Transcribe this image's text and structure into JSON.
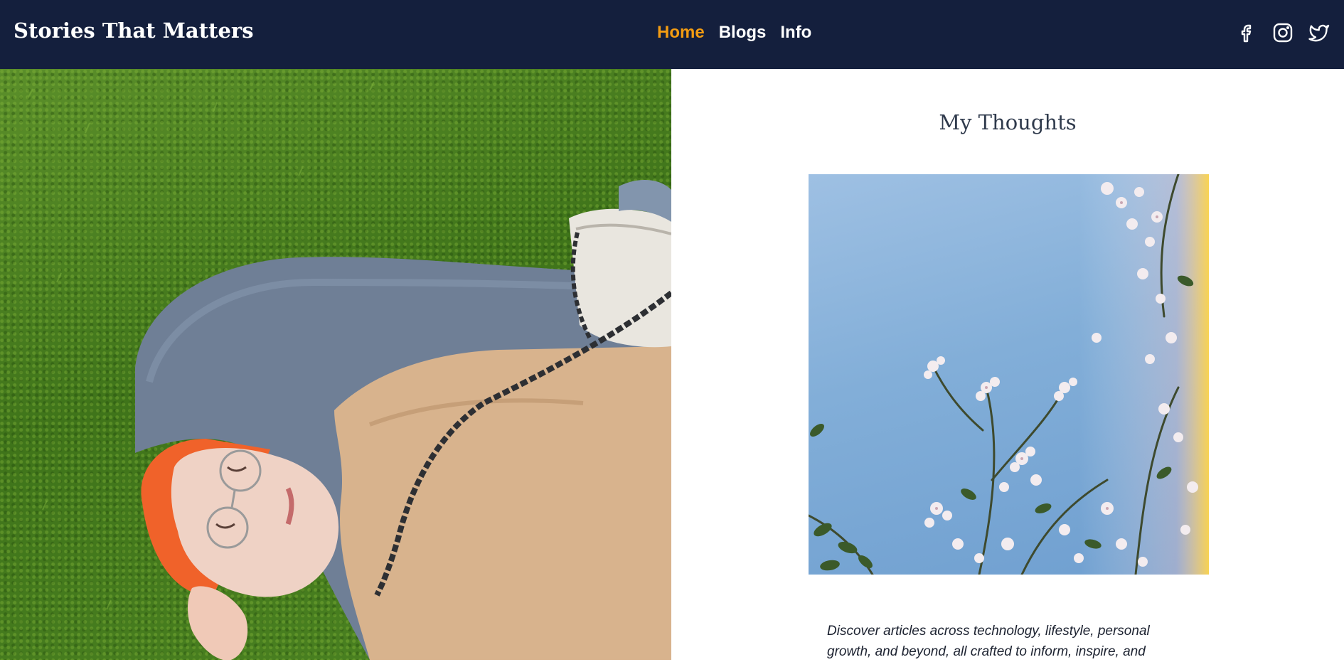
{
  "navbar": {
    "brand": "Stories That Matters",
    "links": [
      {
        "label": "Home",
        "active": true
      },
      {
        "label": "Blogs",
        "active": false
      },
      {
        "label": "Info",
        "active": false
      }
    ],
    "socials": [
      "facebook-icon",
      "instagram-icon",
      "twitter-icon"
    ]
  },
  "main": {
    "section_title": "My Thoughts",
    "intro_text": "Discover articles across technology, lifestyle, personal growth, and beyond, all crafted to inform, inspire, and"
  },
  "colors": {
    "navbar_bg": "#141f3d",
    "accent": "#f39c12",
    "text_light": "#ffffff",
    "heading": "#2f3a4c"
  }
}
